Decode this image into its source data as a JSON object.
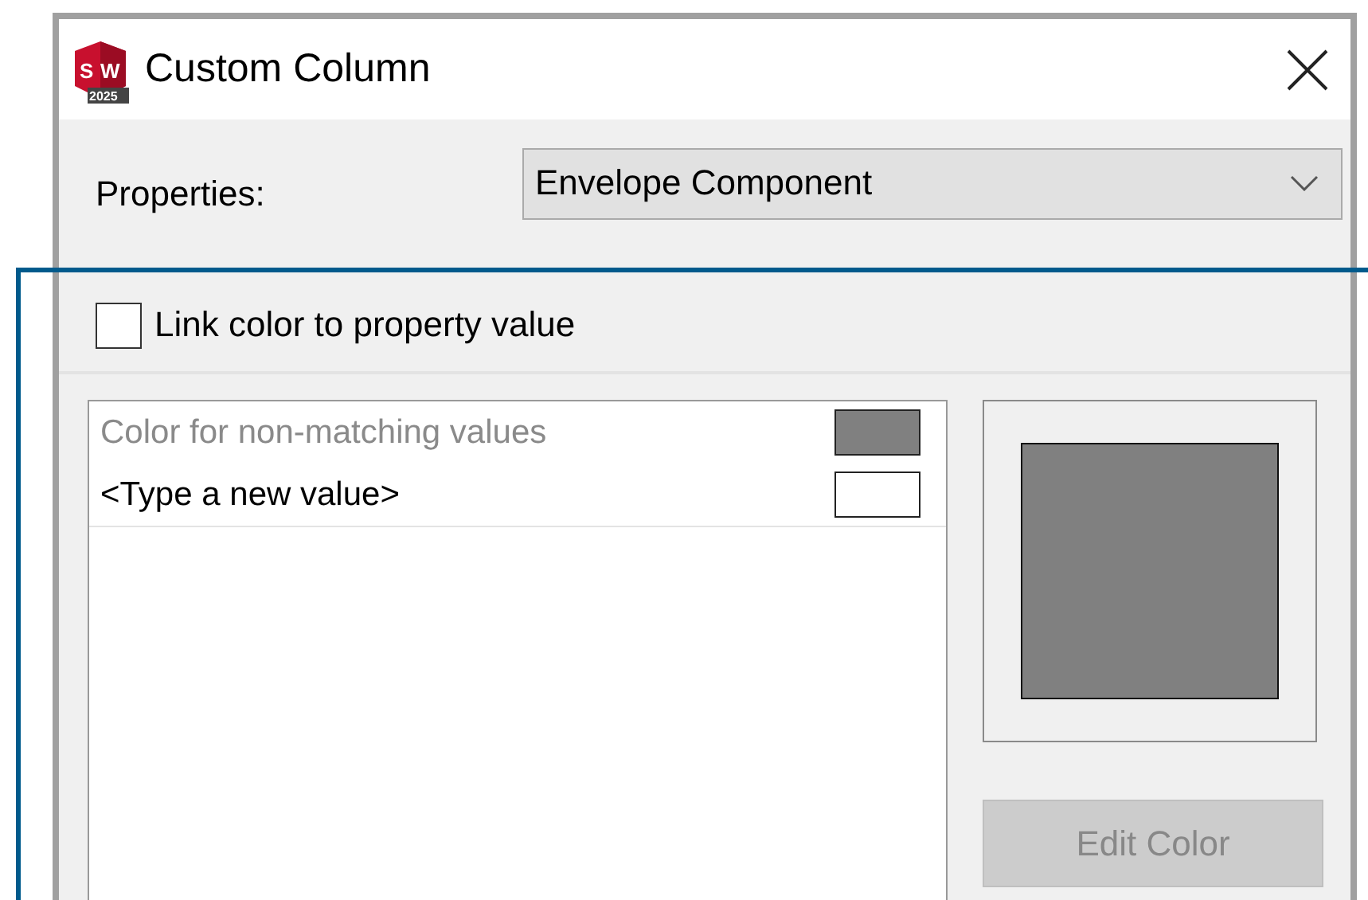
{
  "window": {
    "title": "Custom Column",
    "logo": {
      "letters": [
        "S",
        "W"
      ],
      "year": "2025"
    }
  },
  "properties": {
    "label": "Properties:",
    "value": "Envelope Component"
  },
  "link_color": {
    "label": "Link color to property value",
    "checked": false
  },
  "values": [
    {
      "text": "Color for non-matching values",
      "disabled": true,
      "color": "#808080"
    },
    {
      "text": "<Type a new value>",
      "disabled": false,
      "color": "#ffffff"
    }
  ],
  "preview": {
    "color": "#808080"
  },
  "edit_button": {
    "label": "Edit Color",
    "disabled": true
  },
  "highlight": {
    "visible": true
  }
}
